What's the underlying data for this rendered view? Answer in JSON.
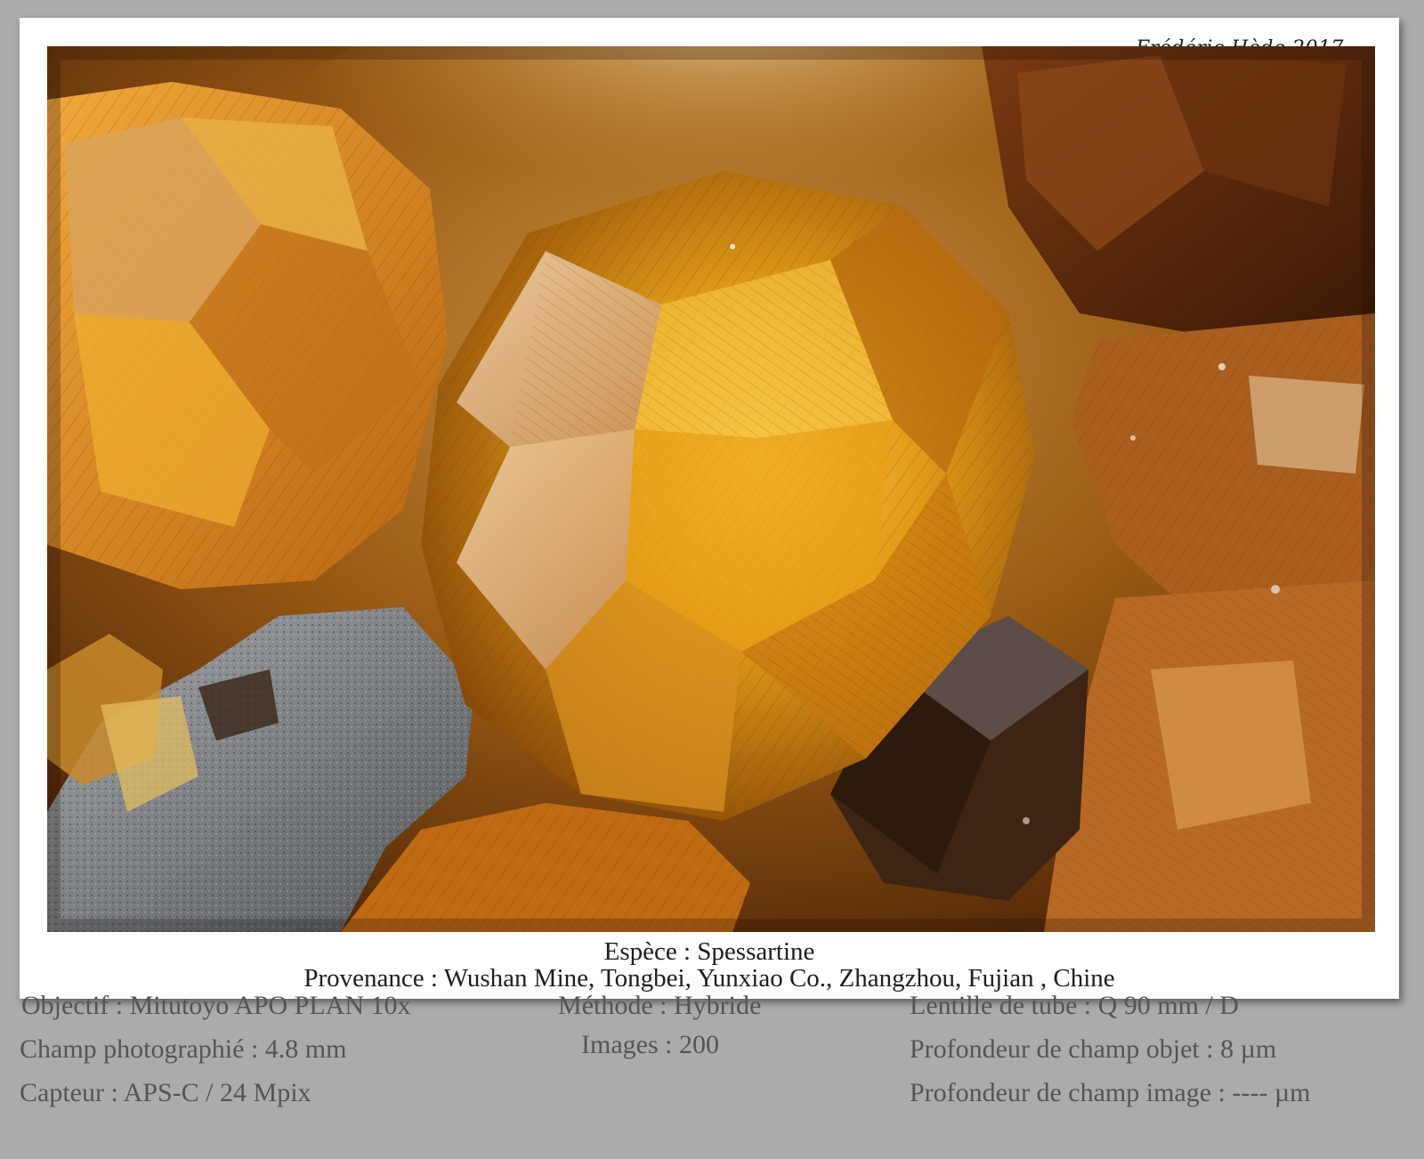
{
  "credit": "Frédéric Hède 2017",
  "caption": {
    "species": "Espèce : Spessartine",
    "provenance": "Provenance : Wushan Mine, Tongbei, Yunxiao Co., Zhangzhou, Fujian , Chine"
  },
  "details": {
    "objective": "Objectif : Mitutoyo APO PLAN 10x",
    "field": "Champ photographié : 4.8 mm",
    "sensor": "Capteur : APS-C / 24 Mpix",
    "method": "Méthode : Hybride",
    "images": "Images : 200",
    "tube_lens": "Lentille de tube : Q 90 mm / D",
    "object_dof": "Profondeur de champ objet : 8 µm",
    "image_dof": "Profondeur de champ image : ---- µm"
  },
  "colors": {
    "background": "#ababab",
    "card": "#ffffff",
    "crystal_gold": "#e0a020",
    "crystal_dark": "#5a2e0a",
    "matrix_gray": "#7d8084"
  }
}
